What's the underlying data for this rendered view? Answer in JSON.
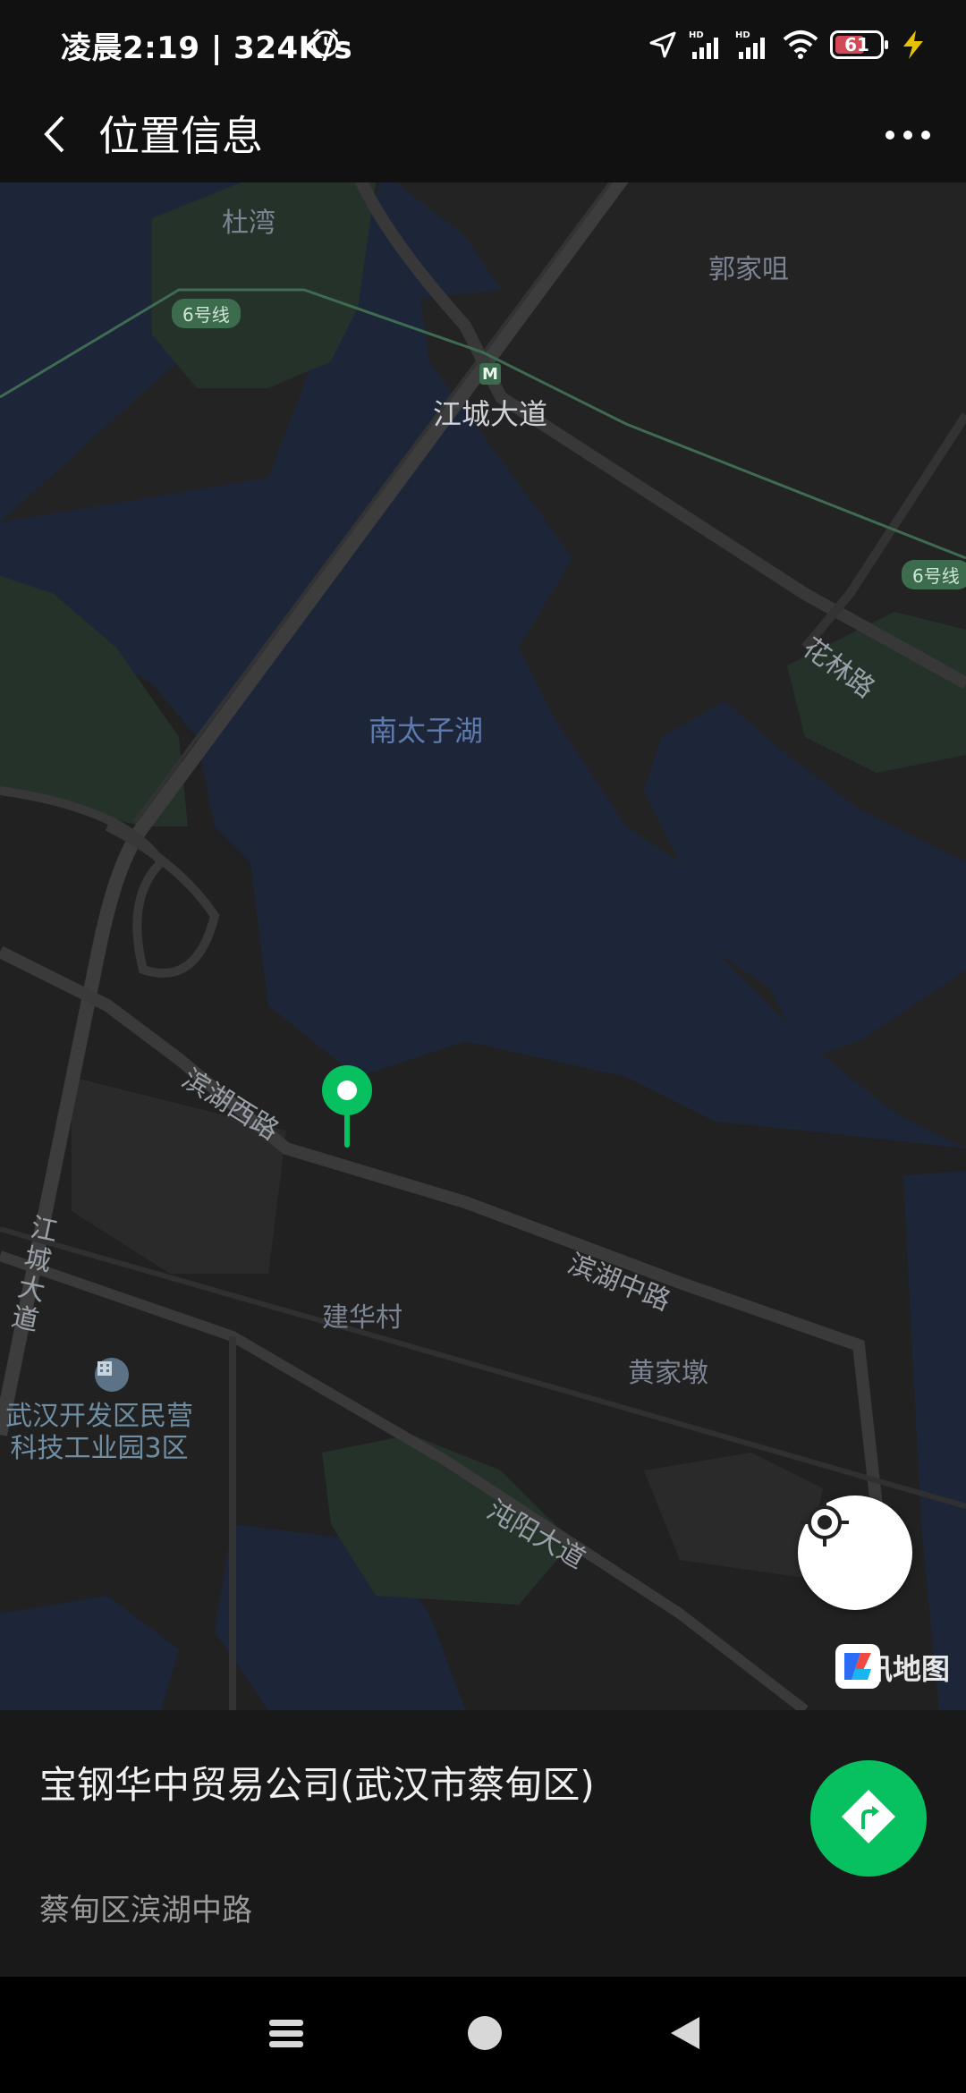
{
  "status_bar": {
    "time": "凌晨2:19 | 324K/s",
    "battery_level": "61",
    "icons": [
      "alarm-icon",
      "location-arrow-icon",
      "signal-hd-icon",
      "signal-hd-icon",
      "wifi-icon",
      "battery-icon",
      "charging-icon"
    ]
  },
  "title_bar": {
    "title": "位置信息",
    "back_icon": "chevron-left-icon",
    "more_icon": "more-dots-icon"
  },
  "map": {
    "labels": {
      "duwan": "杜湾",
      "guojiazui": "郭家咀",
      "line6_a": "6号线",
      "line6_b": "6号线",
      "jiangcheng_station": "江城大道",
      "hualin_road": "花林路",
      "lake": "南太子湖",
      "binhu_west": "滨湖西路",
      "jiangcheng_road": "江城大道",
      "jianhua_village": "建华村",
      "binhu_middle": "滨湖中路",
      "huangjiadun": "黄家墩",
      "poi_industrial": "武汉开发区民营\n科技工业园3区",
      "zhuanyang_road": "沌阳大道"
    },
    "provider": "腾讯地图",
    "metro_marker": "M"
  },
  "place": {
    "name": "宝钢华中贸易公司(武汉市蔡甸区)",
    "address": "蔡甸区滨湖中路"
  },
  "colors": {
    "accent_green": "#07c160",
    "water": "#1d2638",
    "land": "#202020",
    "background": "#111111"
  }
}
